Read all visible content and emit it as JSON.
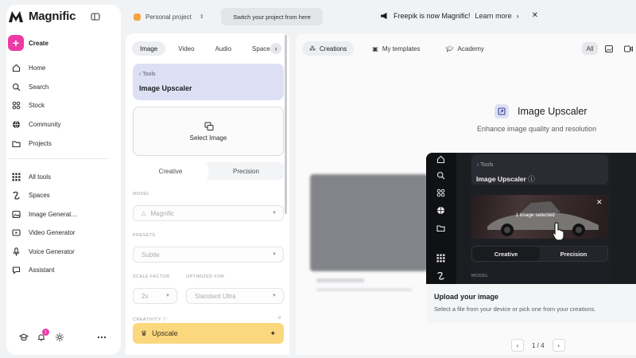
{
  "brand": {
    "name": "Magnific"
  },
  "sidebar": {
    "create_label": "Create",
    "items": [
      {
        "label": "Home",
        "icon": "home-icon"
      },
      {
        "label": "Search",
        "icon": "search-icon"
      },
      {
        "label": "Stock",
        "icon": "stock-icon"
      },
      {
        "label": "Community",
        "icon": "globe-icon"
      },
      {
        "label": "Projects",
        "icon": "folder-icon"
      }
    ],
    "tools": [
      {
        "label": "All tools",
        "icon": "grid-icon"
      },
      {
        "label": "Spaces",
        "icon": "spaces-icon"
      },
      {
        "label": "Image Generat…",
        "icon": "image-icon"
      },
      {
        "label": "Video Generator",
        "icon": "video-icon"
      },
      {
        "label": "Voice Generator",
        "icon": "mic-icon"
      },
      {
        "label": "Assistant",
        "icon": "assistant-icon"
      }
    ],
    "notification_count": "1"
  },
  "topbar": {
    "project": "Personal project",
    "tooltip": "Switch your project from here",
    "announcement": "Freepik is now Magnific!",
    "learn_more": "Learn more"
  },
  "tool_panel": {
    "tabs": [
      "Image",
      "Video",
      "Audio",
      "Spaces"
    ],
    "back_label": "Tools",
    "tool_name": "Image Upscaler",
    "select_image": "Select Image",
    "modes": [
      "Creative",
      "Precision"
    ],
    "model_label": "MODEL",
    "model_value": "Magnific",
    "presets_label": "PRESETS",
    "preset_value": "Subtle",
    "scale_label": "SCALE FACTOR",
    "optimized_label": "OPTIMIZED FOR",
    "scale_value": "2x",
    "optimized_value": "Standard Ultra",
    "creativity_label": "CREATIVITY",
    "creativity_value": "-2",
    "upscale_button": "Upscale"
  },
  "main": {
    "tabs": [
      "Creations",
      "My templates",
      "Academy"
    ],
    "filters": [
      "All"
    ],
    "hero_title": "Image Upscaler",
    "hero_subtitle": "Enhance image quality and resolution",
    "preview": {
      "back_label": "Tools",
      "tool_name": "Image Upscaler",
      "selected_text": "1 image selected",
      "modes": [
        "Creative",
        "Precision"
      ],
      "model_label": "MODEL",
      "footer_title": "Upload your image",
      "footer_subtitle": "Select a file from your device or pick one from your creations."
    },
    "pager": "1 / 4"
  },
  "colors": {
    "accent": "#ec3aa6",
    "upscale": "#fbd77e",
    "card": "#dde0f5"
  }
}
